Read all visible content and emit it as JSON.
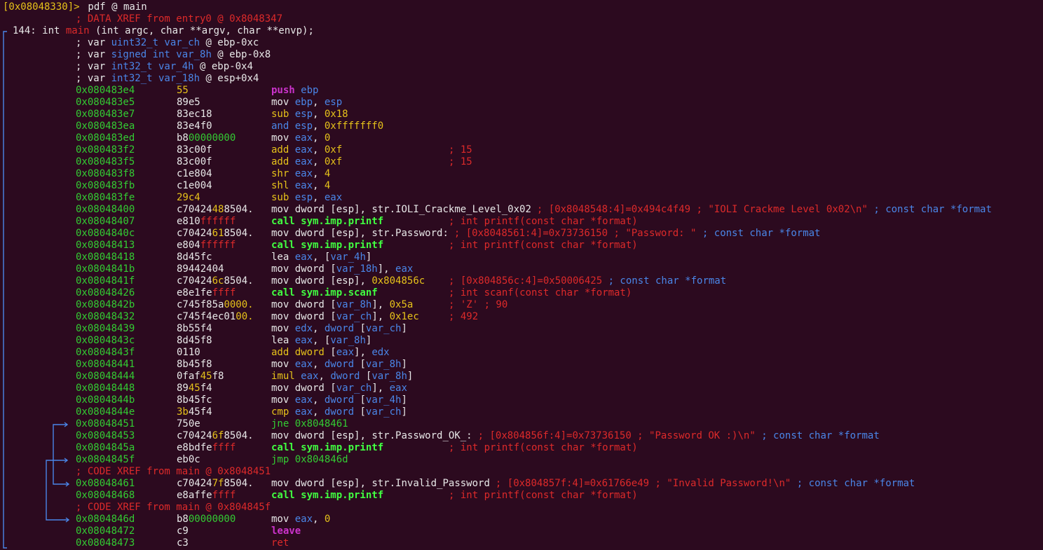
{
  "colors": {
    "bg": "#2c0a1f",
    "white": "#e8e8e8",
    "red": "#dd2a2a",
    "green": "#33cc33",
    "yellow": "#e6c21a",
    "blue": "#4a86e8",
    "magenta": "#cc33cc",
    "boldgreen": "#41ff41"
  },
  "prompt": {
    "addr": "[0x08048330]>",
    "command": " pdf @ main"
  },
  "header": [
    {
      "kind": "comment",
      "segs": [
        [
          "; DATA XREF from entry0 @ 0x8048347",
          "red"
        ]
      ]
    },
    {
      "kind": "sig",
      "segs": [
        [
          "144: int ",
          "white"
        ],
        [
          "main",
          "red"
        ],
        [
          " (int argc, char **argv, char **envp);",
          "white"
        ]
      ]
    },
    {
      "kind": "var",
      "segs": [
        [
          "; var ",
          "white"
        ],
        [
          "uint32_t var_ch",
          "blue"
        ],
        [
          " @ ebp-0xc",
          "white"
        ]
      ]
    },
    {
      "kind": "var",
      "segs": [
        [
          "; var ",
          "white"
        ],
        [
          "signed int var_8h",
          "blue"
        ],
        [
          " @ ebp-0x8",
          "white"
        ]
      ]
    },
    {
      "kind": "var",
      "segs": [
        [
          "; var ",
          "white"
        ],
        [
          "int32_t var_4h",
          "blue"
        ],
        [
          " @ ebp-0x4",
          "white"
        ]
      ]
    },
    {
      "kind": "var",
      "segs": [
        [
          "; var ",
          "white"
        ],
        [
          "int32_t var_18h",
          "blue"
        ],
        [
          " @ esp+0x4",
          "white"
        ]
      ]
    }
  ],
  "instructions": [
    {
      "addr": "0x080483e4",
      "bytes": [
        [
          "55",
          "yellow"
        ]
      ],
      "op": [
        [
          "push",
          "magenta"
        ],
        [
          " ebp",
          "blue"
        ]
      ],
      "comment": []
    },
    {
      "addr": "0x080483e5",
      "bytes": [
        [
          "89e5",
          "white"
        ]
      ],
      "op": [
        [
          "mov ",
          "white"
        ],
        [
          "ebp",
          "blue"
        ],
        [
          ", ",
          "white"
        ],
        [
          "esp",
          "blue"
        ]
      ],
      "comment": []
    },
    {
      "addr": "0x080483e7",
      "bytes": [
        [
          "83ec18",
          "white"
        ]
      ],
      "op": [
        [
          "sub ",
          "yellow"
        ],
        [
          "esp",
          "blue"
        ],
        [
          ", ",
          "white"
        ],
        [
          "0x18",
          "yellow"
        ]
      ],
      "comment": []
    },
    {
      "addr": "0x080483ea",
      "bytes": [
        [
          "83e4f0",
          "white"
        ]
      ],
      "op": [
        [
          "and ",
          "blue"
        ],
        [
          "esp",
          "blue"
        ],
        [
          ", ",
          "white"
        ],
        [
          "0xfffffff0",
          "yellow"
        ]
      ],
      "comment": []
    },
    {
      "addr": "0x080483ed",
      "bytes": [
        [
          "b8",
          "white"
        ],
        [
          "00000000",
          "green"
        ]
      ],
      "op": [
        [
          "mov ",
          "white"
        ],
        [
          "eax",
          "blue"
        ],
        [
          ", ",
          "white"
        ],
        [
          "0",
          "yellow"
        ]
      ],
      "comment": []
    },
    {
      "addr": "0x080483f2",
      "bytes": [
        [
          "83c00f",
          "white"
        ]
      ],
      "op": [
        [
          "add ",
          "yellow"
        ],
        [
          "eax",
          "blue"
        ],
        [
          ", ",
          "white"
        ],
        [
          "0xf",
          "yellow"
        ]
      ],
      "comment": [
        [
          "; 15",
          "red"
        ]
      ]
    },
    {
      "addr": "0x080483f5",
      "bytes": [
        [
          "83c00f",
          "white"
        ]
      ],
      "op": [
        [
          "add ",
          "yellow"
        ],
        [
          "eax",
          "blue"
        ],
        [
          ", ",
          "white"
        ],
        [
          "0xf",
          "yellow"
        ]
      ],
      "comment": [
        [
          "; 15",
          "red"
        ]
      ]
    },
    {
      "addr": "0x080483f8",
      "bytes": [
        [
          "c1e804",
          "white"
        ]
      ],
      "op": [
        [
          "shr ",
          "yellow"
        ],
        [
          "eax",
          "blue"
        ],
        [
          ", ",
          "white"
        ],
        [
          "4",
          "yellow"
        ]
      ],
      "comment": []
    },
    {
      "addr": "0x080483fb",
      "bytes": [
        [
          "c1e004",
          "white"
        ]
      ],
      "op": [
        [
          "shl ",
          "yellow"
        ],
        [
          "eax",
          "blue"
        ],
        [
          ", ",
          "white"
        ],
        [
          "4",
          "yellow"
        ]
      ],
      "comment": []
    },
    {
      "addr": "0x080483fe",
      "bytes": [
        [
          "29c4",
          "yellow"
        ]
      ],
      "op": [
        [
          "sub ",
          "yellow"
        ],
        [
          "esp",
          "blue"
        ],
        [
          ", ",
          "white"
        ],
        [
          "eax",
          "blue"
        ]
      ],
      "comment": []
    },
    {
      "addr": "0x08048400",
      "bytes": [
        [
          "c70424",
          "white"
        ],
        [
          "48",
          "yellow"
        ],
        [
          "8504.",
          "white"
        ]
      ],
      "op": [
        [
          "mov dword ",
          "white"
        ],
        [
          "[esp]",
          "white"
        ],
        [
          ", ",
          "white"
        ],
        [
          "str.IOLI_Crackme_Level_0x02",
          "white"
        ]
      ],
      "comment": [
        [
          "; [0x8048548:4]=0x494c4f49 ; \"IOLI Crackme Level 0x02\\n\" ",
          "red"
        ],
        [
          "; const char *format",
          "blue"
        ]
      ]
    },
    {
      "addr": "0x08048407",
      "bytes": [
        [
          "e810",
          "white"
        ],
        [
          "ffffff",
          "red"
        ]
      ],
      "op": [
        [
          "call sym.imp.printf",
          "boldgreen"
        ]
      ],
      "comment": [
        [
          "; int printf(const char *format)",
          "red"
        ]
      ]
    },
    {
      "addr": "0x0804840c",
      "bytes": [
        [
          "c70424",
          "white"
        ],
        [
          "61",
          "yellow"
        ],
        [
          "8504.",
          "white"
        ]
      ],
      "op": [
        [
          "mov dword ",
          "white"
        ],
        [
          "[esp]",
          "white"
        ],
        [
          ", ",
          "white"
        ],
        [
          "str.Password:",
          "white"
        ]
      ],
      "comment": [
        [
          "; [0x8048561:4]=0x73736150 ; \"Password: \" ",
          "red"
        ],
        [
          "; const char *format",
          "blue"
        ]
      ]
    },
    {
      "addr": "0x08048413",
      "bytes": [
        [
          "e804",
          "white"
        ],
        [
          "ffffff",
          "red"
        ]
      ],
      "op": [
        [
          "call sym.imp.printf",
          "boldgreen"
        ]
      ],
      "comment": [
        [
          "; int printf(const char *format)",
          "red"
        ]
      ]
    },
    {
      "addr": "0x08048418",
      "bytes": [
        [
          "8d45fc",
          "white"
        ]
      ],
      "op": [
        [
          "lea ",
          "white"
        ],
        [
          "eax",
          "blue"
        ],
        [
          ", [",
          "white"
        ],
        [
          "var_4h",
          "blue"
        ],
        [
          "]",
          "white"
        ]
      ],
      "comment": []
    },
    {
      "addr": "0x0804841b",
      "bytes": [
        [
          "89442404",
          "white"
        ]
      ],
      "op": [
        [
          "mov dword ",
          "white"
        ],
        [
          "[",
          "white"
        ],
        [
          "var_18h",
          "blue"
        ],
        [
          "], ",
          "white"
        ],
        [
          "eax",
          "blue"
        ]
      ],
      "comment": []
    },
    {
      "addr": "0x0804841f",
      "bytes": [
        [
          "c70424",
          "white"
        ],
        [
          "6c",
          "yellow"
        ],
        [
          "8504.",
          "white"
        ]
      ],
      "op": [
        [
          "mov dword ",
          "white"
        ],
        [
          "[esp]",
          "white"
        ],
        [
          ", ",
          "white"
        ],
        [
          "0x804856c",
          "yellow"
        ]
      ],
      "comment": [
        [
          "; [0x804856c:4]=0x50006425 ",
          "red"
        ],
        [
          "; const char *format",
          "blue"
        ]
      ]
    },
    {
      "addr": "0x08048426",
      "bytes": [
        [
          "e8e1fe",
          "white"
        ],
        [
          "ffff",
          "red"
        ]
      ],
      "op": [
        [
          "call sym.imp.scanf",
          "boldgreen"
        ]
      ],
      "comment": [
        [
          "; int scanf(const char *format)",
          "red"
        ]
      ]
    },
    {
      "addr": "0x0804842b",
      "bytes": [
        [
          "c745f85a",
          "white"
        ],
        [
          "0000.",
          "yellow"
        ]
      ],
      "op": [
        [
          "mov dword ",
          "white"
        ],
        [
          "[",
          "white"
        ],
        [
          "var_8h",
          "blue"
        ],
        [
          "], ",
          "white"
        ],
        [
          "0x5a",
          "yellow"
        ]
      ],
      "comment": [
        [
          "; 'Z' ; 90",
          "red"
        ]
      ]
    },
    {
      "addr": "0x08048432",
      "bytes": [
        [
          "c745f4ec01",
          "white"
        ],
        [
          "00.",
          "yellow"
        ]
      ],
      "op": [
        [
          "mov dword ",
          "white"
        ],
        [
          "[",
          "white"
        ],
        [
          "var_ch",
          "blue"
        ],
        [
          "], ",
          "white"
        ],
        [
          "0x1ec",
          "yellow"
        ]
      ],
      "comment": [
        [
          "; 492",
          "red"
        ]
      ]
    },
    {
      "addr": "0x08048439",
      "bytes": [
        [
          "8b55f4",
          "white"
        ]
      ],
      "op": [
        [
          "mov ",
          "white"
        ],
        [
          "edx",
          "blue"
        ],
        [
          ", ",
          "white"
        ],
        [
          "dword ",
          "blue"
        ],
        [
          "[",
          "white"
        ],
        [
          "var_ch",
          "blue"
        ],
        [
          "]",
          "white"
        ]
      ],
      "comment": []
    },
    {
      "addr": "0x0804843c",
      "bytes": [
        [
          "8d45f8",
          "white"
        ]
      ],
      "op": [
        [
          "lea ",
          "white"
        ],
        [
          "eax",
          "blue"
        ],
        [
          ", [",
          "white"
        ],
        [
          "var_8h",
          "blue"
        ],
        [
          "]",
          "white"
        ]
      ],
      "comment": []
    },
    {
      "addr": "0x0804843f",
      "bytes": [
        [
          "0110",
          "white"
        ]
      ],
      "op": [
        [
          "add dword ",
          "yellow"
        ],
        [
          "[",
          "white"
        ],
        [
          "eax",
          "blue"
        ],
        [
          "], ",
          "white"
        ],
        [
          "edx",
          "blue"
        ]
      ],
      "comment": []
    },
    {
      "addr": "0x08048441",
      "bytes": [
        [
          "8b45f8",
          "white"
        ]
      ],
      "op": [
        [
          "mov ",
          "white"
        ],
        [
          "eax",
          "blue"
        ],
        [
          ", ",
          "white"
        ],
        [
          "dword ",
          "blue"
        ],
        [
          "[",
          "white"
        ],
        [
          "var_8h",
          "blue"
        ],
        [
          "]",
          "white"
        ]
      ],
      "comment": []
    },
    {
      "addr": "0x08048444",
      "bytes": [
        [
          "0faf",
          "white"
        ],
        [
          "45",
          "yellow"
        ],
        [
          "f8",
          "white"
        ]
      ],
      "op": [
        [
          "imul ",
          "yellow"
        ],
        [
          "eax",
          "blue"
        ],
        [
          ", ",
          "white"
        ],
        [
          "dword ",
          "blue"
        ],
        [
          "[",
          "white"
        ],
        [
          "var_8h",
          "blue"
        ],
        [
          "]",
          "white"
        ]
      ],
      "comment": []
    },
    {
      "addr": "0x08048448",
      "bytes": [
        [
          "89",
          "white"
        ],
        [
          "45",
          "yellow"
        ],
        [
          "f4",
          "white"
        ]
      ],
      "op": [
        [
          "mov dword ",
          "white"
        ],
        [
          "[",
          "white"
        ],
        [
          "var_ch",
          "blue"
        ],
        [
          "], ",
          "white"
        ],
        [
          "eax",
          "blue"
        ]
      ],
      "comment": []
    },
    {
      "addr": "0x0804844b",
      "bytes": [
        [
          "8b45fc",
          "white"
        ]
      ],
      "op": [
        [
          "mov ",
          "white"
        ],
        [
          "eax",
          "blue"
        ],
        [
          ", ",
          "white"
        ],
        [
          "dword ",
          "blue"
        ],
        [
          "[",
          "white"
        ],
        [
          "var_4h",
          "blue"
        ],
        [
          "]",
          "white"
        ]
      ],
      "comment": []
    },
    {
      "addr": "0x0804844e",
      "bytes": [
        [
          "3b",
          "yellow"
        ],
        [
          "45f4",
          "white"
        ]
      ],
      "op": [
        [
          "cmp ",
          "yellow"
        ],
        [
          "eax",
          "blue"
        ],
        [
          ", ",
          "white"
        ],
        [
          "dword ",
          "blue"
        ],
        [
          "[",
          "white"
        ],
        [
          "var_ch",
          "blue"
        ],
        [
          "]",
          "white"
        ]
      ],
      "comment": []
    },
    {
      "addr": "0x08048451",
      "bytes": [
        [
          "750e",
          "white"
        ]
      ],
      "op": [
        [
          "jne 0x8048461",
          "green"
        ]
      ],
      "comment": []
    },
    {
      "addr": "0x08048453",
      "bytes": [
        [
          "c70424",
          "white"
        ],
        [
          "6f",
          "yellow"
        ],
        [
          "8504.",
          "white"
        ]
      ],
      "op": [
        [
          "mov dword ",
          "white"
        ],
        [
          "[esp]",
          "white"
        ],
        [
          ", ",
          "white"
        ],
        [
          "str.Password_OK_:",
          "white"
        ]
      ],
      "comment": [
        [
          "; [0x804856f:4]=0x73736150 ; \"Password OK :)\\n\" ",
          "red"
        ],
        [
          "; const char *format",
          "blue"
        ]
      ]
    },
    {
      "addr": "0x0804845a",
      "bytes": [
        [
          "e8bdfe",
          "white"
        ],
        [
          "ffff",
          "red"
        ]
      ],
      "op": [
        [
          "call sym.imp.printf",
          "boldgreen"
        ]
      ],
      "comment": [
        [
          "; int printf(const char *format)",
          "red"
        ]
      ]
    },
    {
      "addr": "0x0804845f",
      "bytes": [
        [
          "eb0c",
          "white"
        ]
      ],
      "op": [
        [
          "jmp 0x804846d",
          "green"
        ]
      ],
      "comment": []
    },
    {
      "xref": "; CODE XREF from main @ 0x8048451"
    },
    {
      "addr": "0x08048461",
      "bytes": [
        [
          "c70424",
          "white"
        ],
        [
          "7f",
          "yellow"
        ],
        [
          "8504.",
          "white"
        ]
      ],
      "op": [
        [
          "mov dword ",
          "white"
        ],
        [
          "[esp]",
          "white"
        ],
        [
          ", ",
          "white"
        ],
        [
          "str.Invalid_Password",
          "white"
        ]
      ],
      "comment": [
        [
          "; [0x804857f:4]=0x61766e49 ; \"Invalid Password!\\n\" ",
          "red"
        ],
        [
          "; const char *format",
          "blue"
        ]
      ]
    },
    {
      "addr": "0x08048468",
      "bytes": [
        [
          "e8affe",
          "white"
        ],
        [
          "ffff",
          "red"
        ]
      ],
      "op": [
        [
          "call sym.imp.printf",
          "boldgreen"
        ]
      ],
      "comment": [
        [
          "; int printf(const char *format)",
          "red"
        ]
      ]
    },
    {
      "xref": "; CODE XREF from main @ 0x804845f"
    },
    {
      "addr": "0x0804846d",
      "bytes": [
        [
          "b8",
          "white"
        ],
        [
          "00000000",
          "green"
        ]
      ],
      "op": [
        [
          "mov ",
          "white"
        ],
        [
          "eax",
          "blue"
        ],
        [
          ", ",
          "white"
        ],
        [
          "0",
          "yellow"
        ]
      ],
      "comment": []
    },
    {
      "addr": "0x08048472",
      "bytes": [
        [
          "c9",
          "white"
        ]
      ],
      "op": [
        [
          "leave",
          "magenta"
        ]
      ],
      "comment": []
    },
    {
      "addr": "0x08048473",
      "bytes": [
        [
          "c3",
          "white"
        ]
      ],
      "op": [
        [
          "ret",
          "red"
        ]
      ],
      "comment": []
    }
  ]
}
